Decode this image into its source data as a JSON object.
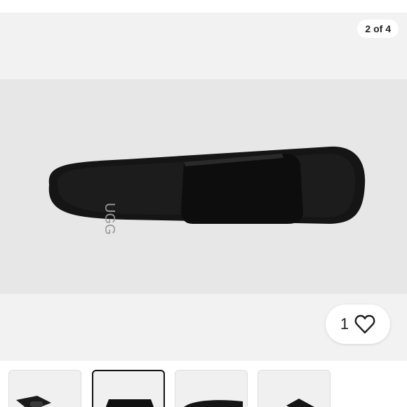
{
  "gallery": {
    "counter": "2 of 4",
    "brand_logo_text": "UGG",
    "like": {
      "count": "1",
      "icon": "heart-outline"
    }
  },
  "thumbnails": [
    {
      "selected": false
    },
    {
      "selected": true
    },
    {
      "selected": false
    },
    {
      "selected": false
    }
  ]
}
